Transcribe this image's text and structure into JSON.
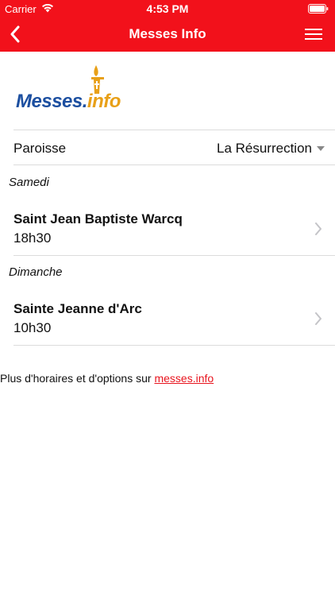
{
  "status_bar": {
    "carrier": "Carrier",
    "time": "4:53 PM"
  },
  "nav": {
    "title": "Messes Info",
    "back_icon": "chevron-left-icon",
    "menu_icon": "hamburger-menu-icon"
  },
  "logo": {
    "text_main": "Messes.",
    "text_accent": "info"
  },
  "parish": {
    "label": "Paroisse",
    "selected": "La Résurrection"
  },
  "schedule": [
    {
      "day": "Samedi",
      "masses": [
        {
          "church": "Saint Jean Baptiste Warcq",
          "time": "18h30"
        }
      ]
    },
    {
      "day": "Dimanche",
      "masses": [
        {
          "church": "Sainte Jeanne d'Arc",
          "time": "10h30"
        }
      ]
    }
  ],
  "footer": {
    "text": "Plus d'horaires et d'options sur ",
    "link_text": "messes.info"
  },
  "colors": {
    "header_red": "#f2111b",
    "logo_blue": "#1c4fa0",
    "logo_orange": "#e8a018",
    "link_red": "#e8141e"
  }
}
